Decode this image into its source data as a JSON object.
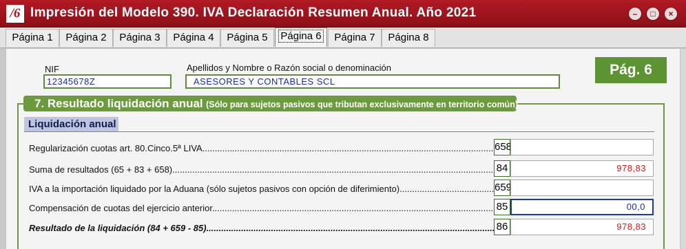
{
  "window": {
    "title": "Impresión del Modelo 390. IVA Declaración Resumen Anual. Año 2021",
    "logo": "/6",
    "buttons": {
      "minimize": "–",
      "maximize": "□",
      "close": "×"
    }
  },
  "tabs": [
    {
      "label": "Página 1"
    },
    {
      "label": "Página 2"
    },
    {
      "label": "Página 3"
    },
    {
      "label": "Página 4"
    },
    {
      "label": "Página 5"
    },
    {
      "label": "Página 6",
      "active": true
    },
    {
      "label": "Página 7"
    },
    {
      "label": "Página 8"
    }
  ],
  "header": {
    "nif_label": "NIF",
    "nif_value": "12345678Z",
    "name_label": "Apellidos y Nombre o Razón social o denominación",
    "name_value": "ASESORES Y CONTABLES SCL",
    "page_badge": "Pág. 6"
  },
  "section": {
    "title": "7. Resultado liquidación anual",
    "subtitle": "(Sólo para sujetos pasivos que tributan exclusivamente en territorio común)",
    "subheader": "Liquidación anual",
    "rows": [
      {
        "label": "Regularización cuotas art. 80.Cinco.5ª LIVA",
        "casilla": "658",
        "value": ""
      },
      {
        "label": "Suma de resultados (65 + 83 + 658)",
        "casilla": "84",
        "value": "978,83"
      },
      {
        "label": "IVA a la importación liquidado por la Aduana (sólo sujetos pasivos con opción de diferimiento)",
        "casilla": "659",
        "value": ""
      },
      {
        "label": "Compensación de cuotas del ejercicio anterior",
        "casilla": "85",
        "value": "00,0"
      },
      {
        "label": "Resultado de la liquidación (84 + 659 - 85)",
        "casilla": "86",
        "value": "978,83"
      }
    ]
  },
  "colors": {
    "titlebar": "#a3121c",
    "accent_green": "#5c9434",
    "value_red": "#d21a1a",
    "field_blue": "#1a2f8f"
  }
}
